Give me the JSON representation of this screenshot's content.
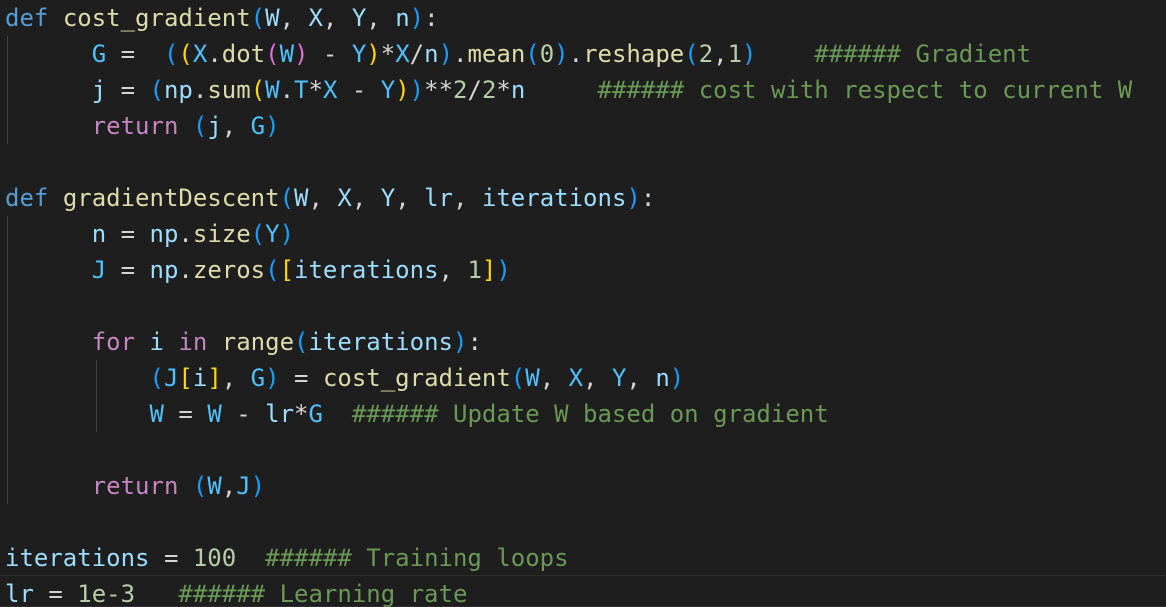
{
  "colors": {
    "background": "#1e1e1e",
    "keyword_def": "#569cd6",
    "keyword_control": "#c586c0",
    "function": "#dcdcaa",
    "parameter": "#9cdcfe",
    "constant": "#4fc1ff",
    "variable": "#9cdcfe",
    "number": "#b5cea8",
    "comment": "#6a9955",
    "operator": "#d4d4d4",
    "bracket_1": "#ffd700",
    "bracket_2": "#da70d6",
    "bracket_3": "#179fff"
  },
  "lines": [
    {
      "tokens": [
        {
          "t": "def",
          "k": "keyword_def"
        },
        {
          "t": " ",
          "k": "operator"
        },
        {
          "t": "cost_gradient",
          "k": "function"
        },
        {
          "t": "(",
          "k": "bracket_3"
        },
        {
          "t": "W",
          "k": "parameter"
        },
        {
          "t": ", ",
          "k": "operator"
        },
        {
          "t": "X",
          "k": "parameter"
        },
        {
          "t": ", ",
          "k": "operator"
        },
        {
          "t": "Y",
          "k": "parameter"
        },
        {
          "t": ", ",
          "k": "operator"
        },
        {
          "t": "n",
          "k": "parameter"
        },
        {
          "t": ")",
          "k": "bracket_3"
        },
        {
          "t": ":",
          "k": "operator"
        }
      ]
    },
    {
      "tokens": [
        {
          "t": "      ",
          "k": "operator"
        },
        {
          "t": "G",
          "k": "constant"
        },
        {
          "t": " =  ",
          "k": "operator"
        },
        {
          "t": "(",
          "k": "bracket_3"
        },
        {
          "t": "(",
          "k": "bracket_1"
        },
        {
          "t": "X",
          "k": "constant"
        },
        {
          "t": ".",
          "k": "operator"
        },
        {
          "t": "dot",
          "k": "function"
        },
        {
          "t": "(",
          "k": "bracket_2"
        },
        {
          "t": "W",
          "k": "constant"
        },
        {
          "t": ")",
          "k": "bracket_2"
        },
        {
          "t": " - ",
          "k": "operator"
        },
        {
          "t": "Y",
          "k": "constant"
        },
        {
          "t": ")",
          "k": "bracket_1"
        },
        {
          "t": "*",
          "k": "operator"
        },
        {
          "t": "X",
          "k": "constant"
        },
        {
          "t": "/",
          "k": "operator"
        },
        {
          "t": "n",
          "k": "variable"
        },
        {
          "t": ")",
          "k": "bracket_3"
        },
        {
          "t": ".",
          "k": "operator"
        },
        {
          "t": "mean",
          "k": "function"
        },
        {
          "t": "(",
          "k": "bracket_3"
        },
        {
          "t": "0",
          "k": "number"
        },
        {
          "t": ")",
          "k": "bracket_3"
        },
        {
          "t": ".",
          "k": "operator"
        },
        {
          "t": "reshape",
          "k": "function"
        },
        {
          "t": "(",
          "k": "bracket_3"
        },
        {
          "t": "2",
          "k": "number"
        },
        {
          "t": ",",
          "k": "operator"
        },
        {
          "t": "1",
          "k": "number"
        },
        {
          "t": ")",
          "k": "bracket_3"
        },
        {
          "t": "    ",
          "k": "operator"
        },
        {
          "t": "###### Gradient",
          "k": "comment"
        }
      ]
    },
    {
      "tokens": [
        {
          "t": "      ",
          "k": "operator"
        },
        {
          "t": "j",
          "k": "variable"
        },
        {
          "t": " = ",
          "k": "operator"
        },
        {
          "t": "(",
          "k": "bracket_3"
        },
        {
          "t": "np",
          "k": "variable"
        },
        {
          "t": ".",
          "k": "operator"
        },
        {
          "t": "sum",
          "k": "function"
        },
        {
          "t": "(",
          "k": "bracket_1"
        },
        {
          "t": "W",
          "k": "constant"
        },
        {
          "t": ".",
          "k": "operator"
        },
        {
          "t": "T",
          "k": "constant"
        },
        {
          "t": "*",
          "k": "operator"
        },
        {
          "t": "X",
          "k": "constant"
        },
        {
          "t": " - ",
          "k": "operator"
        },
        {
          "t": "Y",
          "k": "constant"
        },
        {
          "t": ")",
          "k": "bracket_1"
        },
        {
          "t": ")",
          "k": "bracket_3"
        },
        {
          "t": "**",
          "k": "operator"
        },
        {
          "t": "2",
          "k": "number"
        },
        {
          "t": "/",
          "k": "operator"
        },
        {
          "t": "2",
          "k": "number"
        },
        {
          "t": "*",
          "k": "operator"
        },
        {
          "t": "n",
          "k": "variable"
        },
        {
          "t": "     ",
          "k": "operator"
        },
        {
          "t": "###### cost with respect to current W",
          "k": "comment"
        }
      ]
    },
    {
      "tokens": [
        {
          "t": "      ",
          "k": "operator"
        },
        {
          "t": "return",
          "k": "keyword_control"
        },
        {
          "t": " ",
          "k": "operator"
        },
        {
          "t": "(",
          "k": "bracket_3"
        },
        {
          "t": "j",
          "k": "variable"
        },
        {
          "t": ", ",
          "k": "operator"
        },
        {
          "t": "G",
          "k": "constant"
        },
        {
          "t": ")",
          "k": "bracket_3"
        }
      ]
    },
    {
      "tokens": []
    },
    {
      "tokens": [
        {
          "t": "def",
          "k": "keyword_def"
        },
        {
          "t": " ",
          "k": "operator"
        },
        {
          "t": "gradientDescent",
          "k": "function"
        },
        {
          "t": "(",
          "k": "bracket_3"
        },
        {
          "t": "W",
          "k": "parameter"
        },
        {
          "t": ", ",
          "k": "operator"
        },
        {
          "t": "X",
          "k": "parameter"
        },
        {
          "t": ", ",
          "k": "operator"
        },
        {
          "t": "Y",
          "k": "parameter"
        },
        {
          "t": ", ",
          "k": "operator"
        },
        {
          "t": "lr",
          "k": "parameter"
        },
        {
          "t": ", ",
          "k": "operator"
        },
        {
          "t": "iterations",
          "k": "parameter"
        },
        {
          "t": ")",
          "k": "bracket_3"
        },
        {
          "t": ":",
          "k": "operator"
        }
      ]
    },
    {
      "tokens": [
        {
          "t": "      ",
          "k": "operator"
        },
        {
          "t": "n",
          "k": "variable"
        },
        {
          "t": " = ",
          "k": "operator"
        },
        {
          "t": "np",
          "k": "variable"
        },
        {
          "t": ".",
          "k": "operator"
        },
        {
          "t": "size",
          "k": "function"
        },
        {
          "t": "(",
          "k": "bracket_3"
        },
        {
          "t": "Y",
          "k": "constant"
        },
        {
          "t": ")",
          "k": "bracket_3"
        }
      ]
    },
    {
      "tokens": [
        {
          "t": "      ",
          "k": "operator"
        },
        {
          "t": "J",
          "k": "constant"
        },
        {
          "t": " = ",
          "k": "operator"
        },
        {
          "t": "np",
          "k": "variable"
        },
        {
          "t": ".",
          "k": "operator"
        },
        {
          "t": "zeros",
          "k": "function"
        },
        {
          "t": "(",
          "k": "bracket_3"
        },
        {
          "t": "[",
          "k": "bracket_1"
        },
        {
          "t": "iterations",
          "k": "variable"
        },
        {
          "t": ", ",
          "k": "operator"
        },
        {
          "t": "1",
          "k": "number"
        },
        {
          "t": "]",
          "k": "bracket_1"
        },
        {
          "t": ")",
          "k": "bracket_3"
        }
      ]
    },
    {
      "tokens": []
    },
    {
      "tokens": [
        {
          "t": "      ",
          "k": "operator"
        },
        {
          "t": "for",
          "k": "keyword_control"
        },
        {
          "t": " ",
          "k": "operator"
        },
        {
          "t": "i",
          "k": "variable"
        },
        {
          "t": " ",
          "k": "operator"
        },
        {
          "t": "in",
          "k": "keyword_control"
        },
        {
          "t": " ",
          "k": "operator"
        },
        {
          "t": "range",
          "k": "function"
        },
        {
          "t": "(",
          "k": "bracket_3"
        },
        {
          "t": "iterations",
          "k": "variable"
        },
        {
          "t": ")",
          "k": "bracket_3"
        },
        {
          "t": ":",
          "k": "operator"
        }
      ]
    },
    {
      "tokens": [
        {
          "t": "          ",
          "k": "operator"
        },
        {
          "t": "(",
          "k": "bracket_3"
        },
        {
          "t": "J",
          "k": "constant"
        },
        {
          "t": "[",
          "k": "bracket_1"
        },
        {
          "t": "i",
          "k": "variable"
        },
        {
          "t": "]",
          "k": "bracket_1"
        },
        {
          "t": ", ",
          "k": "operator"
        },
        {
          "t": "G",
          "k": "constant"
        },
        {
          "t": ")",
          "k": "bracket_3"
        },
        {
          "t": " = ",
          "k": "operator"
        },
        {
          "t": "cost_gradient",
          "k": "function"
        },
        {
          "t": "(",
          "k": "bracket_3"
        },
        {
          "t": "W",
          "k": "constant"
        },
        {
          "t": ", ",
          "k": "operator"
        },
        {
          "t": "X",
          "k": "constant"
        },
        {
          "t": ", ",
          "k": "operator"
        },
        {
          "t": "Y",
          "k": "constant"
        },
        {
          "t": ", ",
          "k": "operator"
        },
        {
          "t": "n",
          "k": "variable"
        },
        {
          "t": ")",
          "k": "bracket_3"
        }
      ]
    },
    {
      "tokens": [
        {
          "t": "          ",
          "k": "operator"
        },
        {
          "t": "W",
          "k": "constant"
        },
        {
          "t": " = ",
          "k": "operator"
        },
        {
          "t": "W",
          "k": "constant"
        },
        {
          "t": " - ",
          "k": "operator"
        },
        {
          "t": "lr",
          "k": "variable"
        },
        {
          "t": "*",
          "k": "operator"
        },
        {
          "t": "G",
          "k": "constant"
        },
        {
          "t": "  ",
          "k": "operator"
        },
        {
          "t": "###### Update W based on gradient",
          "k": "comment"
        }
      ]
    },
    {
      "tokens": []
    },
    {
      "tokens": [
        {
          "t": "      ",
          "k": "operator"
        },
        {
          "t": "return",
          "k": "keyword_control"
        },
        {
          "t": " ",
          "k": "operator"
        },
        {
          "t": "(",
          "k": "bracket_3"
        },
        {
          "t": "W",
          "k": "constant"
        },
        {
          "t": ",",
          "k": "operator"
        },
        {
          "t": "J",
          "k": "constant"
        },
        {
          "t": ")",
          "k": "bracket_3"
        }
      ]
    },
    {
      "tokens": []
    },
    {
      "tokens": [
        {
          "t": "iterations",
          "k": "variable"
        },
        {
          "t": " = ",
          "k": "operator"
        },
        {
          "t": "100",
          "k": "number"
        },
        {
          "t": "  ",
          "k": "operator"
        },
        {
          "t": "###### Training loops",
          "k": "comment"
        }
      ]
    },
    {
      "tokens": [
        {
          "t": "lr",
          "k": "variable"
        },
        {
          "t": " = ",
          "k": "operator"
        },
        {
          "t": "1e-3",
          "k": "number"
        },
        {
          "t": "   ",
          "k": "operator"
        },
        {
          "t": "###### Learning rate",
          "k": "comment"
        }
      ]
    }
  ]
}
